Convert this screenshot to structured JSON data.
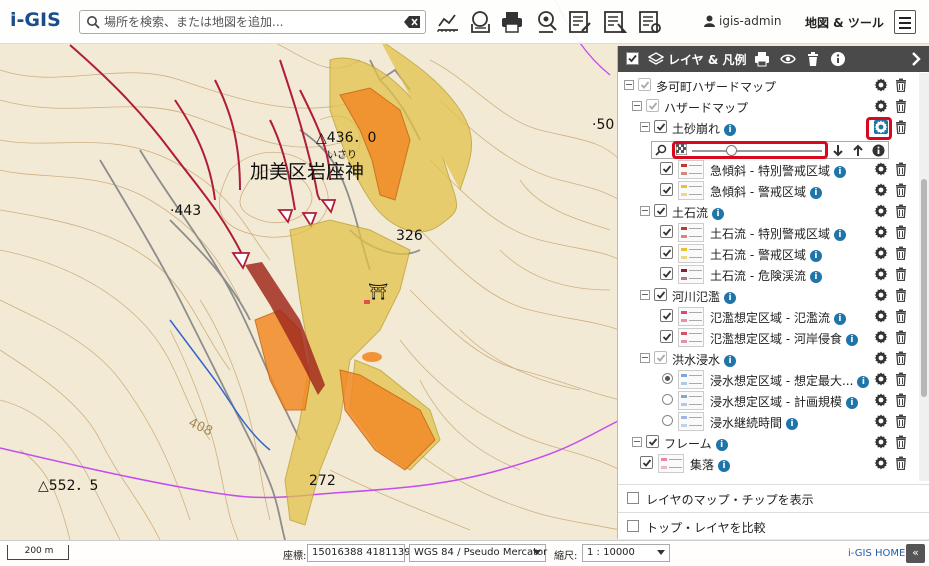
{
  "app": {
    "logo": "i-GIS",
    "search_placeholder": "場所を検索、または地図を追加...",
    "user": "igis-admin",
    "map_tools": "地図 & ツール",
    "accent_color": "#1f74a8",
    "highlight_color": "#d8081d"
  },
  "toolbar_icons": [
    "measure-icon",
    "map-chip-icon",
    "print-icon",
    "map-pin-icon",
    "edit-layer-icon",
    "edit-attribute-icon",
    "edit-list-icon"
  ],
  "map": {
    "labels": {
      "place_name": "加美区岩座神",
      "place_reading": "いさり",
      "peak_436": "△436．0",
      "elev_443": "·443",
      "elev_326": "326",
      "peak_552": "△552．5",
      "elev_272": "272",
      "elev_50x": "·50",
      "elev_408": "408",
      "shrine": "⛩"
    }
  },
  "panel": {
    "title": "レイヤ & 凡例",
    "footer_options": [
      {
        "label": "レイヤのマップ・チップを表示"
      },
      {
        "label": "トップ・レイヤを比較"
      }
    ],
    "rows": [
      {
        "label": "多可町ハザードマップ",
        "type": "group",
        "level": 0,
        "checked": true,
        "dim": true,
        "info": false
      },
      {
        "label": "ハザードマップ",
        "type": "group",
        "level": 1,
        "checked": true,
        "dim": true,
        "info": false
      },
      {
        "label": "土砂崩れ",
        "type": "group",
        "level": 2,
        "checked": true,
        "dim": false,
        "info": true,
        "highlight_gear": true
      },
      {
        "label": "",
        "type": "slider",
        "level": 2,
        "opacity": 0.3
      },
      {
        "label": "急傾斜 - 特別警戒区域",
        "type": "layer",
        "level": 3,
        "checked": true,
        "info": true,
        "swatch": "#c0392b"
      },
      {
        "label": "急傾斜 - 警戒区域",
        "type": "layer",
        "level": 3,
        "checked": true,
        "info": true,
        "swatch": "#e6c230"
      },
      {
        "label": "土石流",
        "type": "group",
        "level": 2,
        "checked": true,
        "dim": false,
        "info": true
      },
      {
        "label": "土石流 - 特別警戒区域",
        "type": "layer",
        "level": 3,
        "checked": true,
        "info": true,
        "swatch": "#c0392b"
      },
      {
        "label": "土石流 - 警戒区域",
        "type": "layer",
        "level": 3,
        "checked": true,
        "info": true,
        "swatch": "#e6c230"
      },
      {
        "label": "土石流 - 危険渓流",
        "type": "layer",
        "level": 3,
        "checked": true,
        "info": true,
        "swatch": "#8e1a3a"
      },
      {
        "label": "河川氾濫",
        "type": "group",
        "level": 2,
        "checked": true,
        "dim": false,
        "info": true
      },
      {
        "label": "氾濫想定区域 - 氾濫流",
        "type": "layer",
        "level": 3,
        "checked": true,
        "info": true,
        "swatch": "#d94c6a"
      },
      {
        "label": "氾濫想定区域 - 河岸侵食",
        "type": "layer",
        "level": 3,
        "checked": true,
        "info": true,
        "swatch": "#d94c6a"
      },
      {
        "label": "洪水浸水",
        "type": "group",
        "level": 2,
        "checked": true,
        "dim": true,
        "info": true
      },
      {
        "label": "浸水想定区域 - 想定最大...",
        "type": "radio",
        "level": 3,
        "checked": true,
        "info": true,
        "swatch": "#7fa8d8"
      },
      {
        "label": "浸水想定区域 - 計画規模",
        "type": "radio",
        "level": 3,
        "checked": false,
        "info": true,
        "swatch": "#7fa8d8"
      },
      {
        "label": "浸水継続時間",
        "type": "radio-none",
        "level": 3,
        "checked": false,
        "info": true,
        "swatch": "#9fb8e0"
      },
      {
        "label": "フレーム",
        "type": "group",
        "level": 1,
        "checked": true,
        "dim": false,
        "info": true
      },
      {
        "label": "集落",
        "type": "layer",
        "level": 2,
        "checked": true,
        "info": true,
        "swatch": "#e38aa0"
      }
    ]
  },
  "bottom": {
    "scale": "200 m",
    "coord_label": "座標:",
    "coord_value": "15016388 4181139",
    "crs": "WGS 84 / Pseudo Mercator",
    "ratio_label": "縮尺:",
    "ratio": "1 : 10000",
    "home": "i-GIS HOME",
    "collapse": "«"
  }
}
